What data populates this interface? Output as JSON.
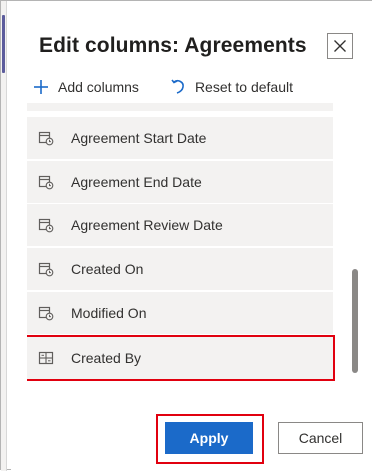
{
  "dialog": {
    "title": "Edit columns: Agreements",
    "close_icon": "close-icon"
  },
  "toolbar": {
    "add_label": "Add columns",
    "add_icon": "plus-icon",
    "reset_label": "Reset to default",
    "reset_icon": "undo-icon"
  },
  "columns": [
    {
      "label": "Agreement Start Date",
      "icon": "calendar-clock-icon",
      "selected": false
    },
    {
      "label": "Agreement End Date",
      "icon": "calendar-clock-icon",
      "selected": false
    },
    {
      "label": "Agreement Review Date",
      "icon": "calendar-clock-icon",
      "selected": false
    },
    {
      "label": "Created On",
      "icon": "calendar-clock-icon",
      "selected": false
    },
    {
      "label": "Modified On",
      "icon": "calendar-clock-icon",
      "selected": false
    },
    {
      "label": "Created By",
      "icon": "lookup-icon",
      "selected": true
    }
  ],
  "footer": {
    "apply_label": "Apply",
    "cancel_label": "Cancel"
  },
  "colors": {
    "primary": "#1b6ac9",
    "highlight": "#e1000f",
    "row_bg": "#f3f2f1"
  }
}
